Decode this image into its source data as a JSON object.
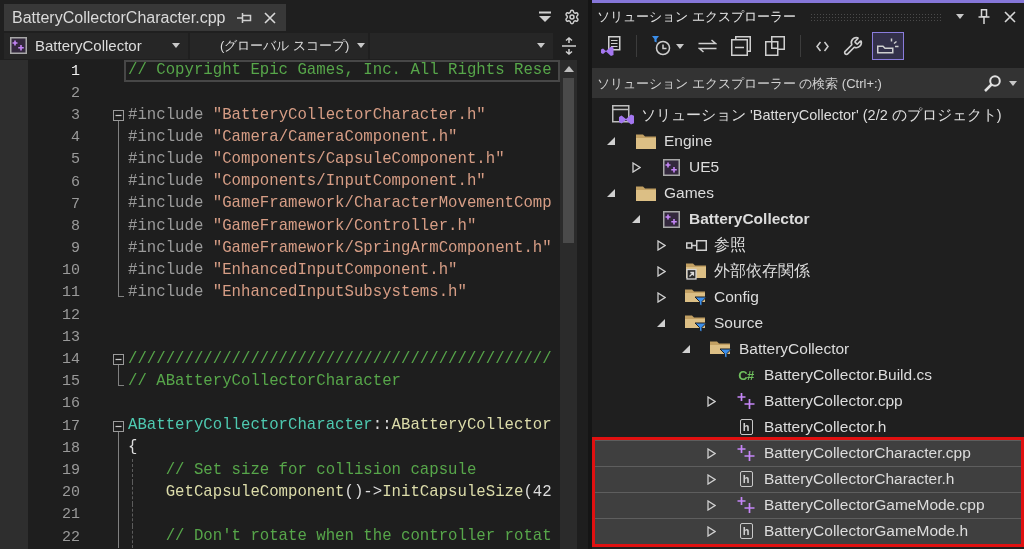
{
  "editor": {
    "tabs": [
      {
        "label": "BatteryCollectorCharacter.cpp",
        "selected": true
      }
    ],
    "navigation": {
      "project": "BatteryCollector",
      "scope": "(グローバル スコープ)"
    },
    "lines": [
      {
        "number": "1",
        "current": true,
        "guide": false,
        "tokens": [
          {
            "kind": "comment",
            "text": "// Copyright Epic Games, Inc. All Rights Rese"
          }
        ]
      },
      {
        "number": "2",
        "current": false,
        "guide": false
      },
      {
        "number": "3",
        "current": false,
        "guide": false,
        "fold": {
          "kind": "start"
        },
        "tokens": [
          {
            "kind": "directive",
            "text": "#include "
          },
          {
            "kind": "string",
            "text": "\"BatteryCollectorCharacter.h\""
          }
        ]
      },
      {
        "number": "4",
        "current": false,
        "guide": false,
        "fold": {
          "kind": "inner"
        },
        "tokens": [
          {
            "kind": "directive",
            "text": "#include "
          },
          {
            "kind": "string",
            "text": "\"Camera/CameraComponent.h\""
          }
        ]
      },
      {
        "number": "5",
        "current": false,
        "guide": false,
        "fold": {
          "kind": "inner"
        },
        "tokens": [
          {
            "kind": "directive",
            "text": "#include "
          },
          {
            "kind": "string",
            "text": "\"Components/CapsuleComponent.h\""
          }
        ]
      },
      {
        "number": "6",
        "current": false,
        "guide": false,
        "fold": {
          "kind": "inner"
        },
        "tokens": [
          {
            "kind": "directive",
            "text": "#include "
          },
          {
            "kind": "string",
            "text": "\"Components/InputComponent.h\""
          }
        ]
      },
      {
        "number": "7",
        "current": false,
        "guide": false,
        "fold": {
          "kind": "inner"
        },
        "tokens": [
          {
            "kind": "directive",
            "text": "#include "
          },
          {
            "kind": "string",
            "text": "\"GameFramework/CharacterMovementComp"
          }
        ]
      },
      {
        "number": "8",
        "current": false,
        "guide": false,
        "fold": {
          "kind": "inner"
        },
        "tokens": [
          {
            "kind": "directive",
            "text": "#include "
          },
          {
            "kind": "string",
            "text": "\"GameFramework/Controller.h\""
          }
        ]
      },
      {
        "number": "9",
        "current": false,
        "guide": false,
        "fold": {
          "kind": "inner"
        },
        "tokens": [
          {
            "kind": "directive",
            "text": "#include "
          },
          {
            "kind": "string",
            "text": "\"GameFramework/SpringArmComponent.h\""
          }
        ]
      },
      {
        "number": "10",
        "current": false,
        "guide": false,
        "fold": {
          "kind": "inner"
        },
        "tokens": [
          {
            "kind": "directive",
            "text": "#include "
          },
          {
            "kind": "string",
            "text": "\"EnhancedInputComponent.h\""
          }
        ]
      },
      {
        "number": "11",
        "current": false,
        "guide": false,
        "fold": {
          "kind": "end"
        },
        "tokens": [
          {
            "kind": "directive",
            "text": "#include "
          },
          {
            "kind": "string",
            "text": "\"EnhancedInputSubsystems.h\""
          }
        ]
      },
      {
        "number": "12",
        "current": false,
        "guide": false
      },
      {
        "number": "13",
        "current": false,
        "guide": false
      },
      {
        "number": "14",
        "current": false,
        "guide": false,
        "fold": {
          "kind": "start"
        },
        "tokens": [
          {
            "kind": "comment",
            "text": "/////////////////////////////////////////////"
          }
        ]
      },
      {
        "number": "15",
        "current": false,
        "guide": false,
        "fold": {
          "kind": "end"
        },
        "tokens": [
          {
            "kind": "comment",
            "text": "// ABatteryCollectorCharacter"
          }
        ]
      },
      {
        "number": "16",
        "current": false,
        "guide": false
      },
      {
        "number": "17",
        "current": false,
        "guide": false,
        "fold": {
          "kind": "start"
        },
        "tokens": [
          {
            "kind": "type",
            "text": "ABatteryCollectorCharacter"
          },
          {
            "kind": "plain",
            "text": "::"
          },
          {
            "kind": "function",
            "text": "ABatteryCollector"
          }
        ]
      },
      {
        "number": "18",
        "current": false,
        "guide": false,
        "fold": {
          "kind": "inner"
        },
        "tokens": [
          {
            "kind": "plain",
            "text": "{"
          }
        ]
      },
      {
        "number": "19",
        "current": false,
        "guide": true,
        "fold": {
          "kind": "inner"
        },
        "tokens": [
          {
            "kind": "comment",
            "text": "    // Set size for collision capsule"
          }
        ]
      },
      {
        "number": "20",
        "current": false,
        "guide": true,
        "fold": {
          "kind": "inner"
        },
        "tokens": [
          {
            "kind": "function",
            "text": "    GetCapsuleComponent"
          },
          {
            "kind": "plain",
            "text": "()->"
          },
          {
            "kind": "function",
            "text": "InitCapsuleSize"
          },
          {
            "kind": "plain",
            "text": "(42"
          }
        ]
      },
      {
        "number": "21",
        "current": false,
        "guide": true,
        "fold": {
          "kind": "inner"
        }
      },
      {
        "number": "22",
        "current": false,
        "guide": true,
        "fold": {
          "kind": "inner"
        },
        "tokens": [
          {
            "kind": "comment",
            "text": "    // Don't rotate when the controller rotat"
          }
        ]
      }
    ]
  },
  "solution_explorer": {
    "title": "ソリューション エクスプローラー",
    "toolbar": [
      {
        "kind": "switch_views",
        "on": false
      },
      {
        "kind": "separator"
      },
      {
        "kind": "pending_changes",
        "on": false
      },
      {
        "kind": "sync",
        "on": false
      },
      {
        "kind": "collapse_all",
        "on": false
      },
      {
        "kind": "show_all_files",
        "on": false
      },
      {
        "kind": "separator"
      },
      {
        "kind": "view_code",
        "on": false
      },
      {
        "kind": "properties",
        "on": false
      },
      {
        "kind": "preview_selected",
        "on": true
      }
    ],
    "search": {
      "placeholder": "ソリューション エクスプローラー の検索 (Ctrl+:)"
    },
    "tree": [
      {
        "label": "ソリューション 'BatteryCollector' (2/2 のプロジェクト)",
        "kind": "solution",
        "selected": false,
        "children": [
          {
            "label": "Engine",
            "kind": "folder",
            "expanded": true,
            "selected": false,
            "children": [
              {
                "label": "UE5",
                "kind": "project",
                "expanded": false,
                "startup": false,
                "selected": false
              }
            ]
          },
          {
            "label": "Games",
            "kind": "folder",
            "expanded": true,
            "selected": false,
            "children": [
              {
                "label": "BatteryCollector",
                "kind": "project",
                "expanded": true,
                "startup": true,
                "selected": false,
                "children": [
                  {
                    "label": "参照",
                    "kind": "references",
                    "expanded": false,
                    "selected": false
                  },
                  {
                    "label": "外部依存関係",
                    "kind": "external",
                    "expanded": false,
                    "selected": false
                  },
                  {
                    "label": "Config",
                    "kind": "filter_folder",
                    "expanded": false,
                    "selected": false
                  },
                  {
                    "label": "Source",
                    "kind": "filter_folder",
                    "expanded": true,
                    "selected": false,
                    "children": [
                      {
                        "label": "BatteryCollector",
                        "kind": "filter_folder",
                        "expanded": true,
                        "selected": false,
                        "children": [
                          {
                            "label": "BatteryCollector.Build.cs",
                            "kind": "csharp",
                            "badge": "C#",
                            "selected": false
                          },
                          {
                            "label": "BatteryCollector.cpp",
                            "kind": "cpp",
                            "expanded": false,
                            "selected": false
                          },
                          {
                            "label": "BatteryCollector.h",
                            "kind": "header",
                            "badge": "h",
                            "selected": false
                          },
                          {
                            "label": "BatteryCollectorCharacter.cpp",
                            "kind": "cpp",
                            "expanded": false,
                            "selected": true
                          },
                          {
                            "label": "BatteryCollectorCharacter.h",
                            "kind": "header",
                            "badge": "h",
                            "expanded": false,
                            "selected": true
                          },
                          {
                            "label": "BatteryCollectorGameMode.cpp",
                            "kind": "cpp",
                            "expanded": false,
                            "selected": true
                          },
                          {
                            "label": "BatteryCollectorGameMode.h",
                            "kind": "header",
                            "badge": "h",
                            "expanded": false,
                            "selected": true
                          }
                        ]
                      }
                    ]
                  }
                ]
              }
            ]
          }
        ]
      }
    ]
  }
}
